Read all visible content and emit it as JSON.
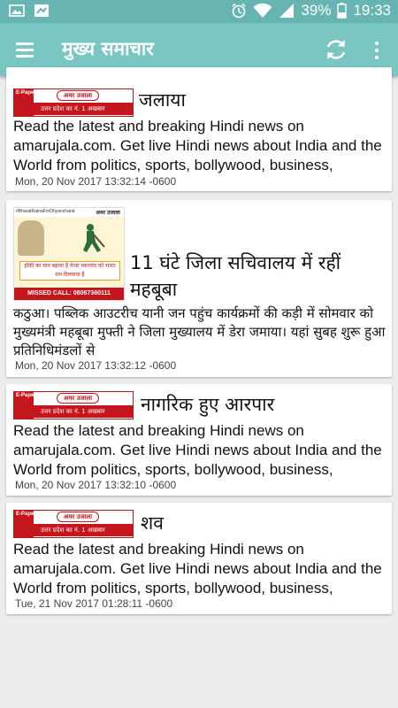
{
  "status_bar": {
    "battery": "39%",
    "time": "19:33",
    "icons": [
      "image-icon",
      "photo-icon",
      "alarm-icon",
      "wifi-icon",
      "signal-icon",
      "battery-icon"
    ]
  },
  "app_bar": {
    "title": "मुख्य समाचार",
    "icons": [
      "menu-icon",
      "refresh-icon",
      "more-vert-icon"
    ]
  },
  "epaper_banner": {
    "tag": "E-Paper",
    "logo": "अमर उजाला",
    "strip": "उत्तर प्रदेश का नं. 1 अखबार"
  },
  "ad_thumb": {
    "hashtag": "#BharatRatnaForDhyanchand",
    "brand": "अमर उजाला",
    "text": "हॉकी का मान बढ़ाया है मेजर ध्यानचंद को भारत रत्न दिलवाना है",
    "call": "MISSED CALL: 08067360111"
  },
  "articles": [
    {
      "headline": "जलाया",
      "description": "Read the latest and breaking Hindi news on amarujala.com. Get live Hindi news about India and the World from politics, sports, bollywood, business,",
      "date": "Mon, 20 Nov 2017 13:32:14 -0600"
    },
    {
      "headline_line1": "11 घंटे जिला सचिवालय में रहीं",
      "headline_line2": "महबूबा",
      "description": "कठुआ। पब्लिक आउटरीच यानी जन पहुंच कार्यक्रमों की कड़ी में सोमवार को मुख्यमंत्री महबूबा मुफ्ती ने जिला मुख्यालय में डेरा जमाया। यहां सुबह शुरू हुआ प्रतिनिधिमंडलों से",
      "date": "Mon, 20 Nov 2017 13:32:12 -0600"
    },
    {
      "headline": "नागरिक हुए आरपार",
      "description": "Read the latest and breaking Hindi news on amarujala.com. Get live Hindi news about India and the World from politics, sports, bollywood, business,",
      "date": "Mon, 20 Nov 2017 13:32:10 -0600"
    },
    {
      "headline": "शव",
      "description": "Read the latest and breaking Hindi news on amarujala.com. Get live Hindi news about India and the World from politics, sports, bollywood, business,",
      "date": "Tue, 21 Nov 2017 01:28:11 -0600"
    }
  ],
  "colors": {
    "status_bar": "#66b5b2",
    "app_bar": "#79c6c3",
    "background": "#ececec",
    "card": "#ffffff",
    "epaper_red": "#c4161c"
  }
}
